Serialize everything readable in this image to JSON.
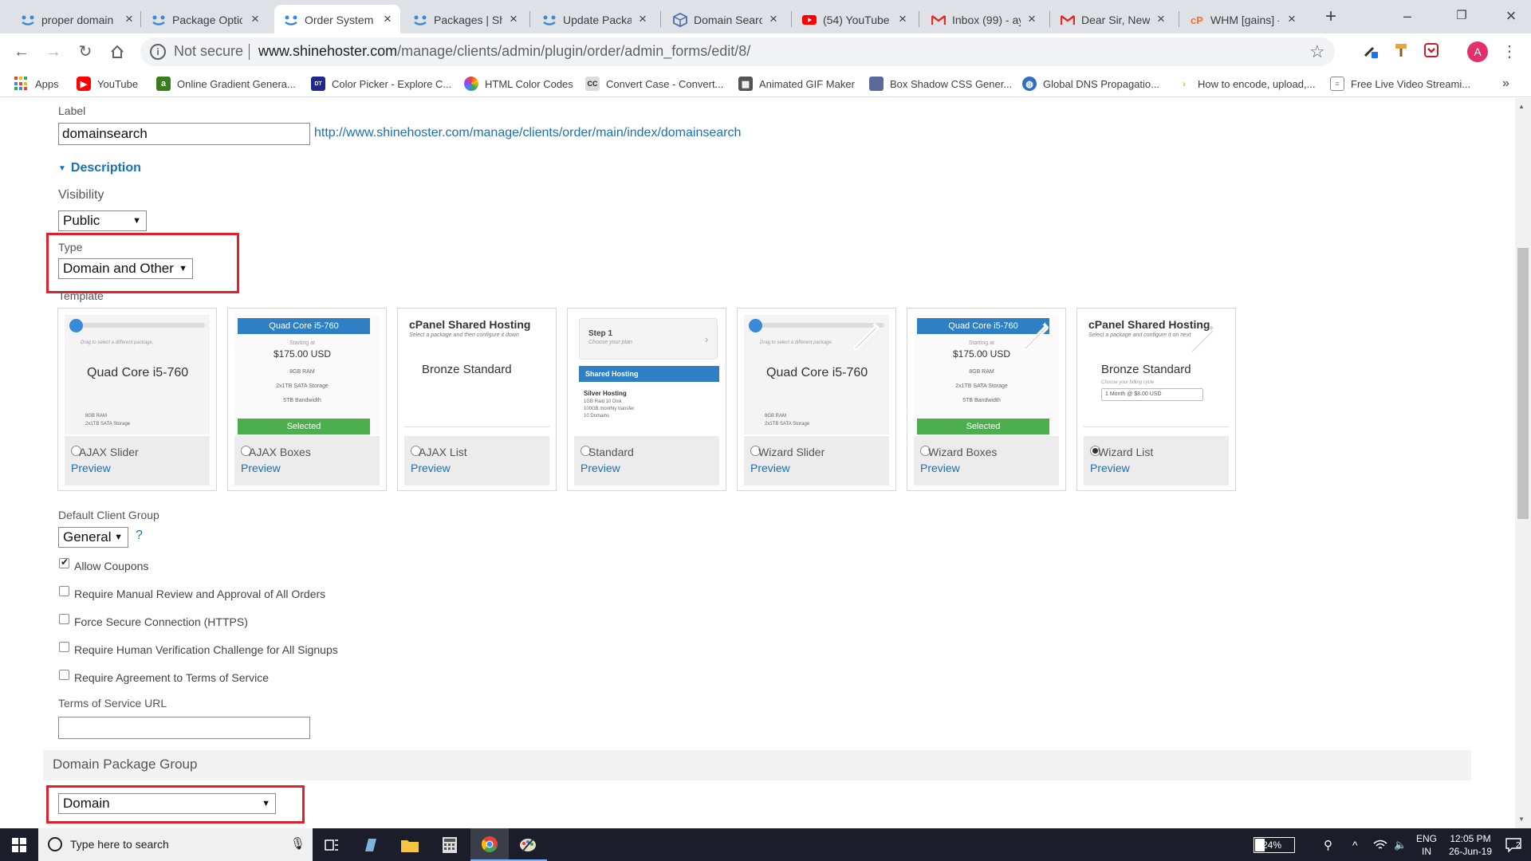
{
  "browser": {
    "tabs": [
      {
        "title": "proper domain",
        "icon": "blue-people-icon"
      },
      {
        "title": "Package Optio",
        "icon": "blue-people-icon"
      },
      {
        "title": "Order System",
        "icon": "blue-people-icon",
        "active": true
      },
      {
        "title": "Packages | Shir",
        "icon": "blue-people-icon"
      },
      {
        "title": "Update Packag",
        "icon": "blue-people-icon"
      },
      {
        "title": "Domain Search",
        "icon": "globe-icon"
      },
      {
        "title": "(54) YouTube",
        "icon": "youtube-icon"
      },
      {
        "title": "Inbox (99) - ay",
        "icon": "gmail-icon"
      },
      {
        "title": "Dear Sir, New",
        "icon": "gmail-icon"
      },
      {
        "title": "WHM [gains] -",
        "icon": "cpanel-icon"
      }
    ],
    "new_tab_symbol": "+",
    "url_security": "Not secure",
    "url_host": "www.shinehoster.com",
    "url_path": "/manage/clients/admin/plugin/order/admin_forms/edit/8/",
    "profile_initial": "A",
    "bookmarks": [
      {
        "label": "Apps",
        "icon": "apps-grid-icon"
      },
      {
        "label": "YouTube",
        "icon": "youtube-icon"
      },
      {
        "label": "Online Gradient Genera...",
        "icon": "gradient-icon"
      },
      {
        "label": "Color Picker - Explore C...",
        "icon": "color-picker-icon"
      },
      {
        "label": "HTML Color Codes",
        "icon": "color-wheel-icon"
      },
      {
        "label": "Convert Case - Convert...",
        "icon": "convert-case-icon"
      },
      {
        "label": "Animated GIF Maker",
        "icon": "gif-icon"
      },
      {
        "label": "Box Shadow CSS Gener...",
        "icon": "box-shadow-icon"
      },
      {
        "label": "Global DNS Propagatio...",
        "icon": "globe-icon"
      },
      {
        "label": "How to encode, upload,...",
        "icon": "arrow-icon"
      },
      {
        "label": "Free Live Video Streami...",
        "icon": "stream-icon"
      }
    ],
    "bookmarks_overflow": "»"
  },
  "form": {
    "label_caption": "Label",
    "label_value": "domainsearch",
    "label_link": "http://www.shinehoster.com/manage/clients/order/main/index/domainsearch",
    "description_toggle": "Description",
    "visibility_caption": "Visibility",
    "visibility_value": "Public",
    "type_caption": "Type",
    "type_value": "Domain and Other",
    "template_caption": "Template",
    "templates": [
      {
        "name": "AJAX Slider",
        "preview": "Preview",
        "selected": false,
        "thumb_text": "Quad Core i5-760",
        "thumb_hint": "Drag to select a different package.",
        "thumb_lines": [
          "8GB RAM",
          "2x1TB SATA Storage"
        ]
      },
      {
        "name": "AJAX Boxes",
        "preview": "Preview",
        "selected": false,
        "thumb_text": "Quad Core i5-760",
        "thumb_price": "$175.00 USD",
        "thumb_start": "Starting at",
        "thumb_lines": [
          "8GB RAM",
          "2x1TB SATA Storage",
          "5TB Bandwidth"
        ],
        "thumb_button": "Selected"
      },
      {
        "name": "AJAX List",
        "preview": "Preview",
        "selected": false,
        "thumb_text": "cPanel Shared Hosting",
        "thumb_sub": "Select a package and then configure it down",
        "thumb_big": "Bronze Standard"
      },
      {
        "name": "Standard",
        "preview": "Preview",
        "selected": false,
        "thumb_step": "Step 1",
        "thumb_hint": "Choose your plan",
        "thumb_band": "Shared Hosting",
        "thumb_lines": [
          "Silver Hosting",
          "1GB Raid 10 Disk",
          "100GB monthly transfer",
          "10 Domains"
        ]
      },
      {
        "name": "Wizard Slider",
        "preview": "Preview",
        "selected": false,
        "thumb_text": "Quad Core i5-760",
        "thumb_hint": "Drag to select a different package.",
        "thumb_lines": [
          "8GB RAM",
          "2x1TB SATA Storage"
        ]
      },
      {
        "name": "Wizard Boxes",
        "preview": "Preview",
        "selected": false,
        "thumb_text": "Quad Core i5-760",
        "thumb_price": "$175.00 USD",
        "thumb_start": "Starting at",
        "thumb_lines": [
          "8GB RAM",
          "2x1TB SATA Storage",
          "5TB Bandwidth"
        ],
        "thumb_button": "Selected"
      },
      {
        "name": "Wizard List",
        "preview": "Preview",
        "selected": true,
        "thumb_text": "cPanel Shared Hosting",
        "thumb_sub": "Select a package and configure it on next",
        "thumb_big": "Bronze Standard",
        "thumb_hint": "Choose your billing cycle",
        "thumb_select": "1 Month @ $8.00 USD"
      }
    ],
    "default_client_group_caption": "Default Client Group",
    "default_client_group_value": "General",
    "help_symbol": "?",
    "checkboxes": [
      {
        "label": "Allow Coupons",
        "checked": true
      },
      {
        "label": "Require Manual Review and Approval of All Orders",
        "checked": false
      },
      {
        "label": "Force Secure Connection (HTTPS)",
        "checked": false
      },
      {
        "label": "Require Human Verification Challenge for All Signups",
        "checked": false
      },
      {
        "label": "Require Agreement to Terms of Service",
        "checked": false
      }
    ],
    "tos_caption": "Terms of Service URL",
    "tos_value": "",
    "domain_group_heading": "Domain Package Group",
    "domain_group_value": "Domain"
  },
  "taskbar": {
    "search_placeholder": "Type here to search",
    "battery": "24%",
    "lang_1": "ENG",
    "lang_2": "IN",
    "time": "12:05 PM",
    "date": "26-Jun-19",
    "notifications": "2"
  },
  "colors": {
    "link": "#1a6fb5",
    "highlight_box": "#e0202a",
    "taskbar": "#1b1e2a",
    "tab_strip": "#dee1e6"
  }
}
